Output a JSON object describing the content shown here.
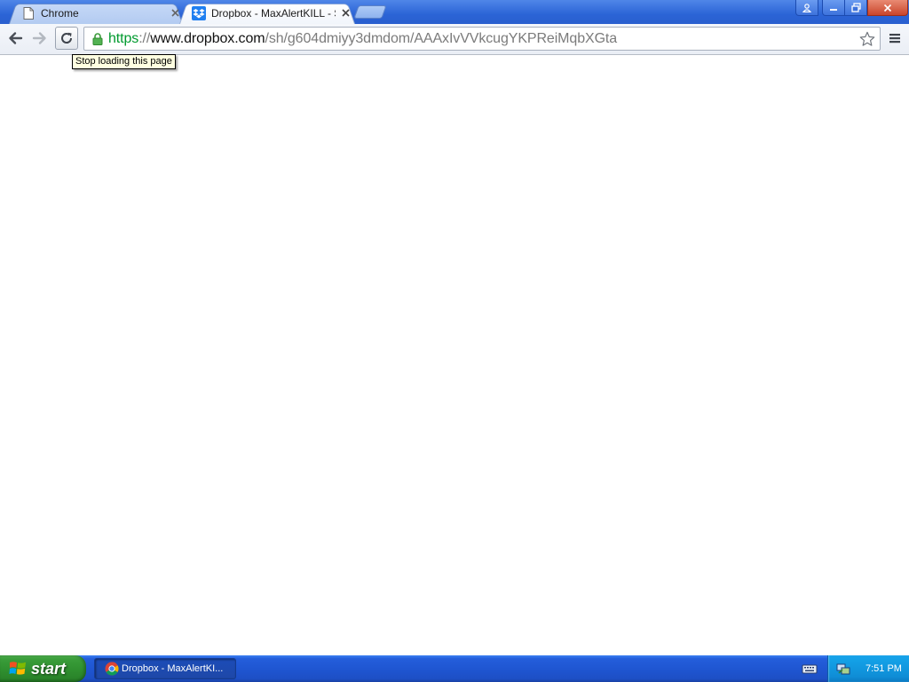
{
  "browser": {
    "tabs": [
      {
        "title": "Chrome",
        "active": false,
        "favicon": "page-icon"
      },
      {
        "title": "Dropbox - MaxAlertKILL - Sim",
        "active": true,
        "favicon": "dropbox-icon"
      }
    ],
    "window_controls": [
      "user-icon",
      "minimize-icon",
      "restore-icon",
      "close-icon"
    ],
    "window_controls_glyphs": {
      "minimize": "—",
      "close": "x"
    },
    "toolbar": {
      "back_icon": "back-arrow-icon",
      "forward_icon": "forward-arrow-icon",
      "reload_icon": "reload-icon",
      "menu_icon": "menu-icon"
    },
    "address_bar": {
      "scheme": "https",
      "separator": "://",
      "host": "www.dropbox.com",
      "path": "/sh/g604dmiyy3dmdom/AAAxIvVVkcugYKPReiMqbXGta",
      "secure": true,
      "bookmark_icon": "star-icon"
    },
    "tooltip": "Stop loading this page"
  },
  "taskbar": {
    "start_label": "start",
    "task_items": [
      {
        "label": "Dropbox - MaxAlertKI...",
        "icon": "chrome-icon"
      }
    ],
    "tray": {
      "clock": "7:51 PM",
      "icons": [
        "keyboard-icon",
        "network-icon"
      ]
    }
  },
  "colors": {
    "titlebar": "#2b64d6",
    "url_scheme": "#009a2e",
    "url_path": "#7b7b7b",
    "taskbar": "#245edb",
    "start_button": "#3a9d3a",
    "tray": "#0f8dd6"
  }
}
